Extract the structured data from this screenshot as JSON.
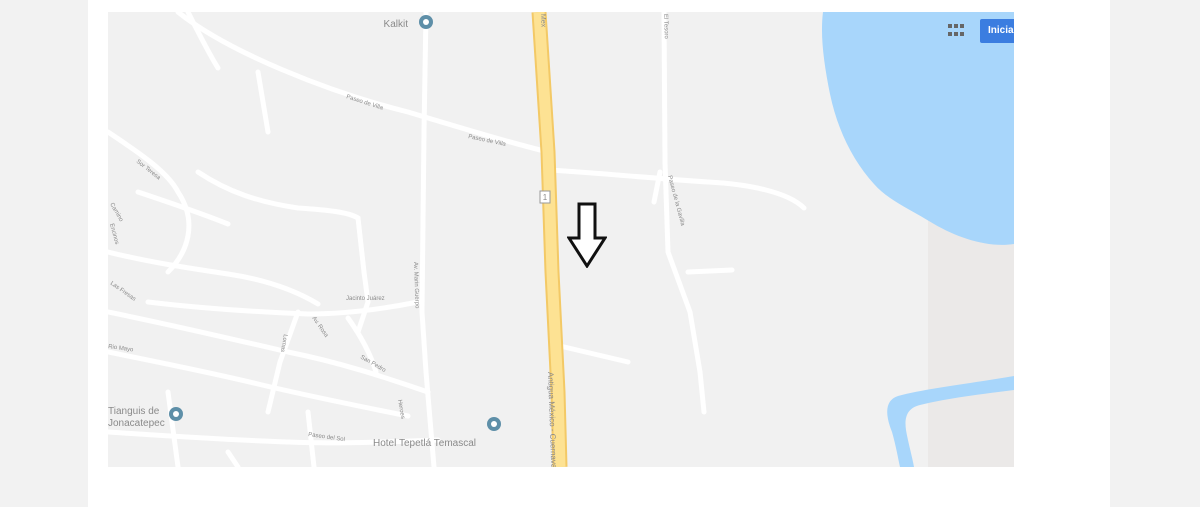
{
  "map": {
    "poi_top": "Kalkit",
    "poi_hotel": "Hotel Tepetlá Temascal",
    "poi_left_line1": "Tianguis de",
    "poi_left_line2": "Jonacatepec",
    "highway_label": "Antigua México - Cuernavaca",
    "highway_top_label": "Mex",
    "highway_shield": "1",
    "road_maza": "Av. Marin Guerpo",
    "road_paseo_1": "Paseo de Villa",
    "road_paseo_2": "Paseo de Villa",
    "road_right": "Paseo de la Gavilla",
    "road_top_right": "El Tesoro",
    "road_middle": "Jacinto Juárez",
    "road_left_1": "Sor Teresa",
    "road_left_2": "Camino",
    "road_left_3": "Encinos",
    "road_left_4": "Las Fresas",
    "road_left_5": "Rio Mayo",
    "road_lower_1": "Av. Rosa",
    "road_lower_2": "San Pedro",
    "road_lower_3": "Heroes",
    "road_lower_4": "Paseo del Sol",
    "road_lower_5": "Lomas"
  },
  "controls": {
    "signin_label": "Iniciar",
    "apps_icon": "apps-grid-icon"
  },
  "colors": {
    "water": "#a8d6fb",
    "highway": "#fde293",
    "map_background": "#f1f1f1",
    "signin_button": "#3b7de0",
    "poi_pin": "#5e8fa8"
  }
}
